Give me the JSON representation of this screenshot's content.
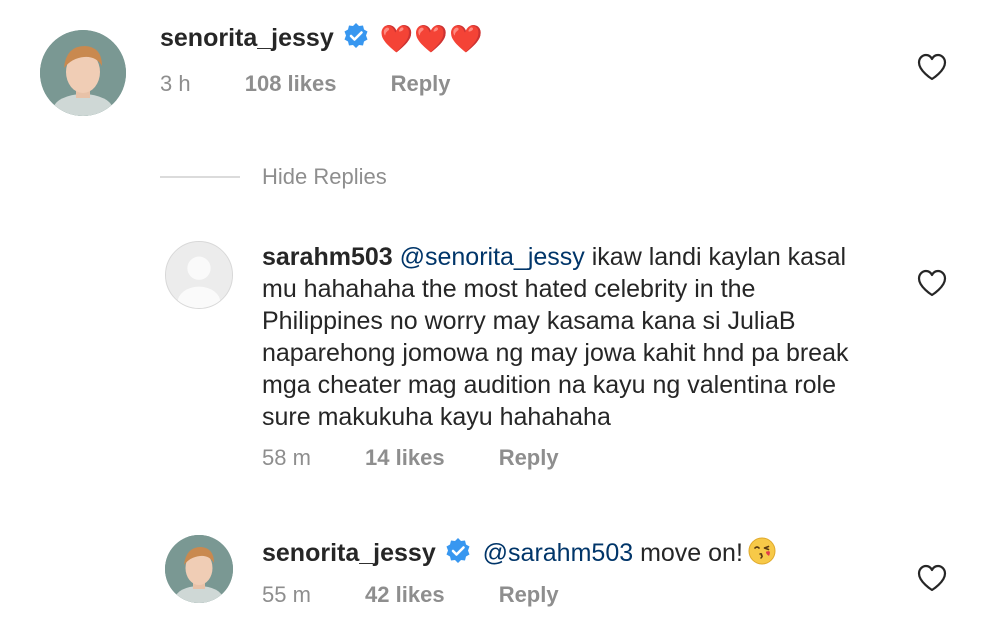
{
  "comment1": {
    "username": "senorita_jessy",
    "emoji": "❤️❤️❤️",
    "time": "3 h",
    "likes": "108 likes",
    "reply": "Reply"
  },
  "hide_replies": "Hide Replies",
  "reply1": {
    "username": "sarahm503",
    "mention": "@senorita_jessy",
    "text": " ikaw landi kaylan kasal mu hahahaha the most hated celebrity in the Philippines no worry may kasama kana si JuliaB naparehong jomowa ng may jowa kahit hnd pa break mga cheater mag audition na kayu ng valentina role sure makukuha kayu hahahaha",
    "time": "58 m",
    "likes": "14 likes",
    "reply": "Reply"
  },
  "reply2": {
    "username": "senorita_jessy",
    "mention": "@sarahm503",
    "text": " move on!",
    "time": "55 m",
    "likes": "42 likes",
    "reply": "Reply"
  },
  "colors": {
    "verified": "#3897f0",
    "mention": "#003569",
    "meta": "#8e8e8e"
  },
  "icons": [
    "verified-badge-icon",
    "heart-outline-icon",
    "kissing-face-emoji",
    "default-avatar-icon"
  ]
}
